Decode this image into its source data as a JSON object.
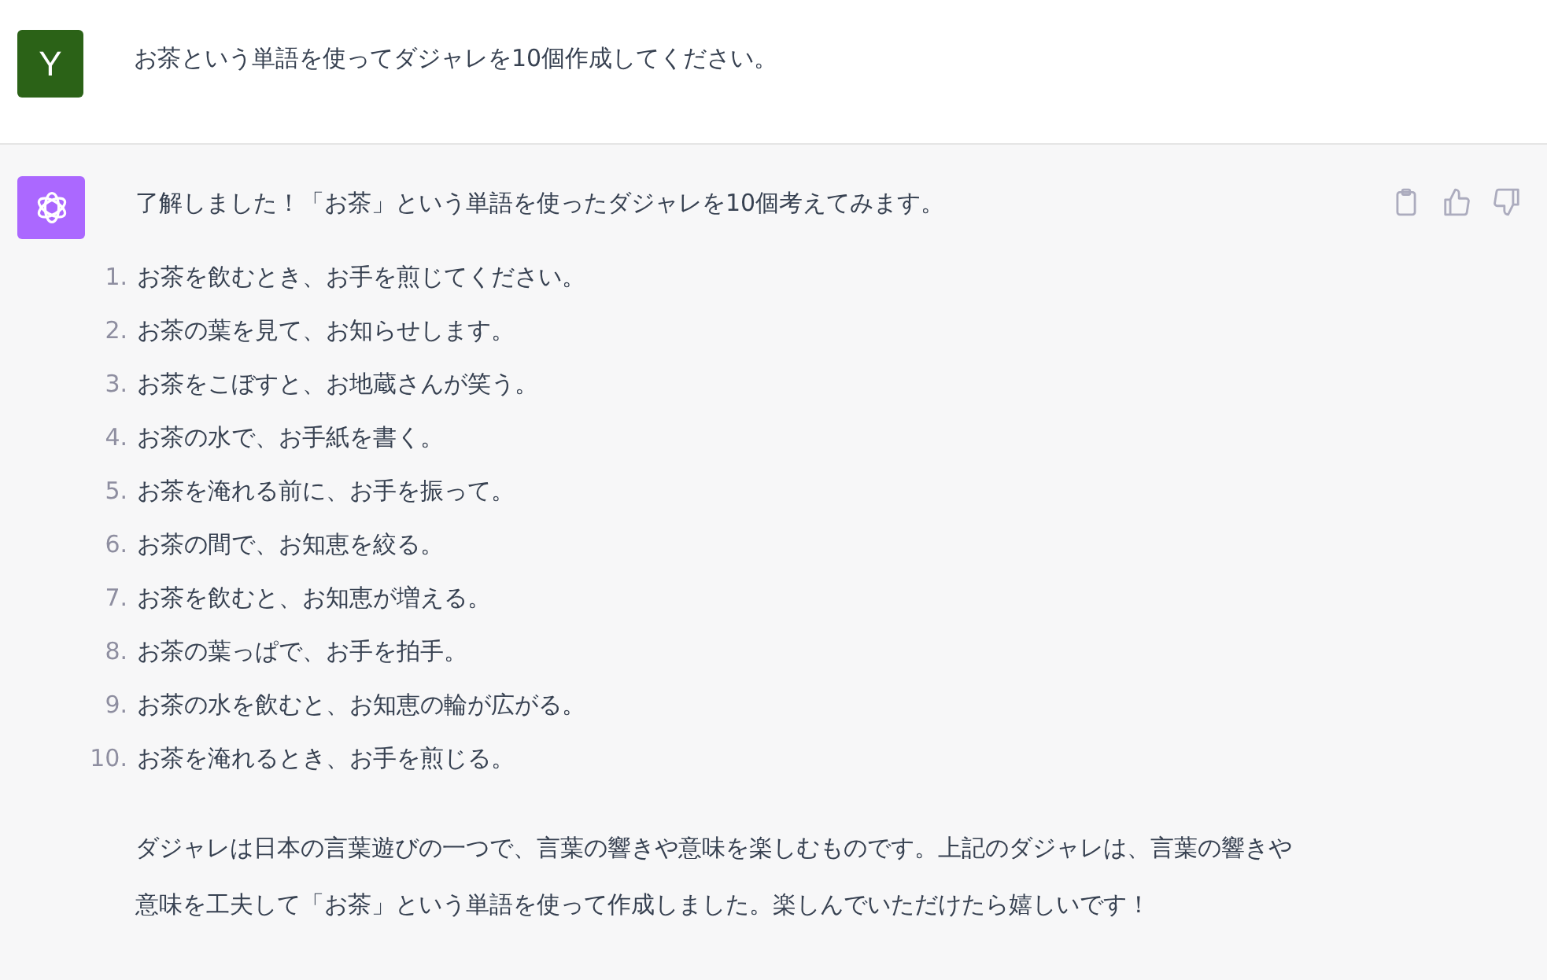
{
  "messages": [
    {
      "kind": "user",
      "avatar": "Y",
      "text": "お茶という単語を使ってダジャレを10個作成してください。"
    },
    {
      "kind": "assistant",
      "text": "了解しました！「お茶」という単語を使ったダジャレを10個考えてみます。",
      "list": [
        {
          "number": "1.",
          "text": "お茶を飲むとき、お手を煎じてください。"
        },
        {
          "number": "2.",
          "text": "お茶の葉を見て、お知らせします。"
        },
        {
          "number": "3.",
          "text": "お茶をこぼすと、お地蔵さんが笑う。"
        },
        {
          "number": "4.",
          "text": "お茶の水で、お手紙を書く。"
        },
        {
          "number": "5.",
          "text": "お茶を淹れる前に、お手を振って。"
        },
        {
          "number": "6.",
          "text": "お茶の間で、お知恵を絞る。"
        },
        {
          "number": "7.",
          "text": "お茶を飲むと、お知恵が増える。"
        },
        {
          "number": "8.",
          "text": "お茶の葉っぱで、お手を拍手。"
        },
        {
          "number": "9.",
          "text": "お茶の水を飲むと、お知恵の輪が広がる。"
        },
        {
          "number": "10.",
          "text": "お茶を淹れるとき、お手を煎じる。"
        }
      ],
      "closing": "ダジャレは日本の言葉遊びの一つで、言葉の響きや意味を楽しむものです。上記のダジャレは、言葉の響きや意味を工夫して「お茶」という単語を使って作成しました。楽しんでいただけたら嬉しいです！",
      "actions": [
        {
          "kind": "copy"
        },
        {
          "kind": "thumbs-up"
        },
        {
          "kind": "thumbs-down"
        }
      ]
    }
  ]
}
